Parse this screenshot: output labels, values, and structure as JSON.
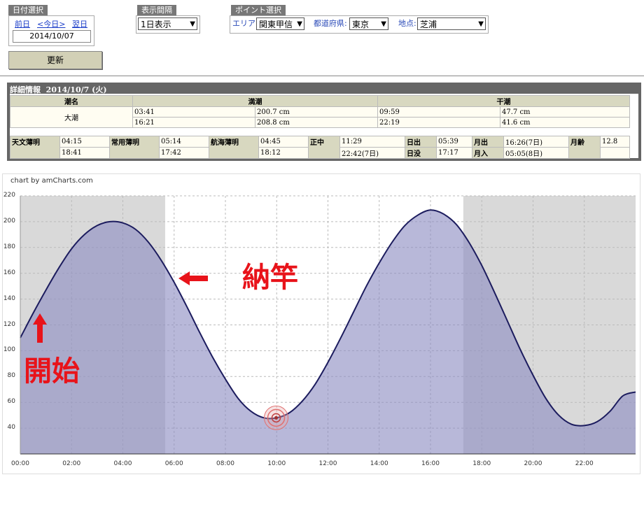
{
  "date_panel": {
    "title": "日付選択",
    "prev": "前日",
    "today": "<今日>",
    "next": "翌日",
    "date": "2014/10/07"
  },
  "interval_panel": {
    "title": "表示間隔",
    "value": "1日表示"
  },
  "point_panel": {
    "title": "ポイント選択",
    "area_label": "エリア:",
    "area_value": "関東甲信",
    "pref_label": "都道府県:",
    "pref_value": "東京",
    "spot_label": "地点:",
    "spot_value": "芝浦"
  },
  "update_button": "更新",
  "detail": {
    "heading": "詳細情報",
    "date": "2014/10/7 (火)",
    "tide_name_label": "潮名",
    "high_label": "満潮",
    "low_label": "干潮",
    "tide_name": "大潮",
    "high": [
      {
        "time": "03:41",
        "level": "200.7 cm"
      },
      {
        "time": "16:21",
        "level": "208.8 cm"
      }
    ],
    "low": [
      {
        "time": "09:59",
        "level": "47.7 cm"
      },
      {
        "time": "22:19",
        "level": "41.6 cm"
      }
    ],
    "astro": {
      "astronomical_twilight": {
        "label": "天文薄明",
        "am": "04:15",
        "pm": "18:41"
      },
      "civil_twilight": {
        "label": "常用薄明",
        "am": "05:14",
        "pm": "17:42"
      },
      "nautical_twilight": {
        "label": "航海薄明",
        "am": "04:45",
        "pm": "18:12"
      },
      "noon": {
        "label": "正中",
        "am": "11:29",
        "pm": "22:42(7日)"
      },
      "sunrise": {
        "label": "日出",
        "value": "05:39"
      },
      "sunset": {
        "label": "日没",
        "value": "17:17"
      },
      "moonrise": {
        "label": "月出",
        "value": "16:26(7日)"
      },
      "moonset": {
        "label": "月入",
        "value": "05:05(8日)"
      },
      "moon_age": {
        "label": "月齢",
        "value": "12.8"
      }
    }
  },
  "chart_credit": "chart by amCharts.com",
  "annotations": {
    "start": "開始",
    "end": "納竿"
  },
  "chart_data": {
    "type": "area",
    "title": "",
    "xlabel": "",
    "ylabel": "",
    "x": [
      0,
      0.5,
      1,
      1.5,
      2,
      2.5,
      3,
      3.5,
      4,
      4.5,
      5,
      5.5,
      6,
      6.5,
      7,
      7.5,
      8,
      8.5,
      9,
      9.5,
      10,
      10.5,
      11,
      11.5,
      12,
      12.5,
      13,
      13.5,
      14,
      14.5,
      15,
      15.5,
      16,
      16.5,
      17,
      17.5,
      18,
      18.5,
      19,
      19.5,
      20,
      20.5,
      21,
      21.5,
      22,
      22.5,
      23,
      23.5,
      24
    ],
    "y": [
      110,
      129,
      147,
      164,
      179,
      190,
      197,
      200,
      199,
      194,
      184,
      170,
      153,
      134,
      114,
      95,
      78,
      63,
      53,
      48,
      48,
      52,
      61,
      74,
      91,
      110,
      130,
      150,
      168,
      184,
      197,
      205,
      209,
      206,
      198,
      184,
      166,
      145,
      123,
      101,
      81,
      63,
      50,
      43,
      42,
      45,
      53,
      65,
      68
    ],
    "x_ticks": [
      "00:00",
      "02:00",
      "04:00",
      "06:00",
      "08:00",
      "10:00",
      "12:00",
      "14:00",
      "16:00",
      "18:00",
      "20:00",
      "22:00"
    ],
    "y_ticks": [
      "40",
      "60",
      "80",
      "100",
      "120",
      "140",
      "160",
      "180",
      "200",
      "220"
    ],
    "ylim": [
      20,
      220
    ],
    "xlim": [
      0,
      24
    ],
    "night_periods": [
      [
        0,
        5.65
      ],
      [
        17.28,
        24
      ]
    ],
    "marker_x": 9.98,
    "grid": true,
    "colors": {
      "line": "#1c1c5e",
      "fill": "#8c8cc2",
      "night": "#d9d9d9"
    }
  }
}
